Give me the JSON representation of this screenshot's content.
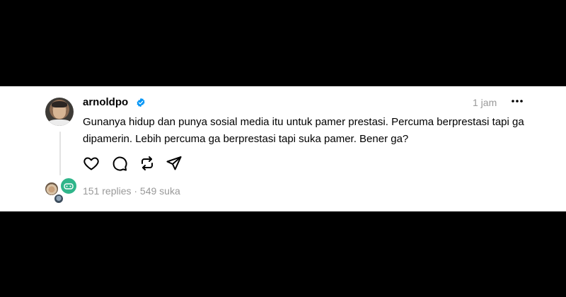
{
  "post": {
    "username": "arnoldpo",
    "verified_icon": "verified-badge-icon",
    "verified_color": "#0095f6",
    "time": "1 jam",
    "more_icon": "more-horizontal-icon",
    "text": "Gunanya hidup dan punya sosial media itu untuk pamer prestasi. Percuma berprestasi tapi ga dipamerin. Lebih percuma ga berprestasi tapi suka pamer. Bener ga?",
    "actions": [
      {
        "icon": "heart-icon"
      },
      {
        "icon": "comment-icon"
      },
      {
        "icon": "repost-icon"
      },
      {
        "icon": "share-icon"
      }
    ],
    "stats": "151 replies · 549 suka"
  },
  "colors": {
    "background": "#000000",
    "card": "#ffffff",
    "text": "#000000",
    "muted": "#999999"
  }
}
